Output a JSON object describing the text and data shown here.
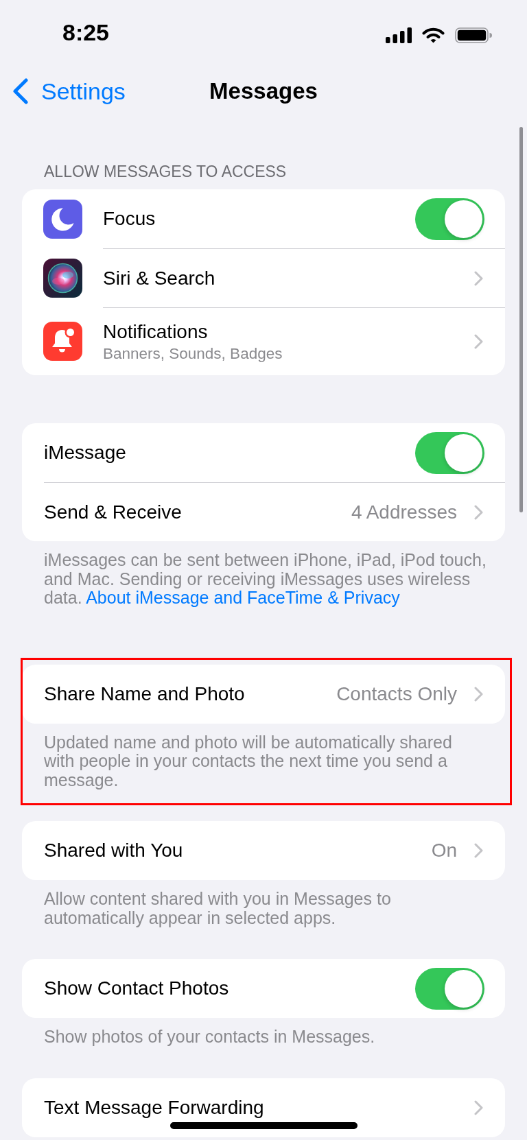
{
  "status_bar": {
    "time": "8:25"
  },
  "nav_bar": {
    "back_label": "Settings",
    "title": "Messages"
  },
  "sections": [
    {
      "header": "ALLOW MESSAGES TO ACCESS",
      "highlighted": false,
      "rows": [
        {
          "kind": "toggle",
          "label": "Focus",
          "on": true
        },
        {
          "kind": "link",
          "label": "Siri & Search"
        },
        {
          "kind": "link",
          "label": "Notifications",
          "subtitle": "Banners, Sounds, Badges"
        }
      ]
    },
    {
      "highlighted": false,
      "rows": [
        {
          "kind": "toggle",
          "label": "iMessage",
          "on": true
        },
        {
          "kind": "link",
          "label": "Send & Receive",
          "value": "4 Addresses"
        }
      ],
      "footer": "iMessages can be sent between iPhone, iPad, iPod touch,\nand Mac. Sending or receiving iMessages uses wireless\ndata.",
      "footer_link": "About iMessage and FaceTime & Privacy"
    },
    {
      "highlighted": true,
      "rows": [
        {
          "kind": "link",
          "label": "Share Name and Photo",
          "value": "Contacts Only"
        }
      ],
      "footer": "Updated name and photo will be automatically shared\nwith people in your contacts the next time you send a\nmessage."
    },
    {
      "highlighted": false,
      "rows": [
        {
          "kind": "link",
          "label": "Shared with You",
          "value": "On"
        }
      ],
      "footer": "Allow content shared with you in Messages to\nautomatically appear in selected apps."
    },
    {
      "highlighted": false,
      "rows": [
        {
          "kind": "toggle",
          "label": "Show Contact Photos",
          "on": true
        }
      ],
      "footer": "Show photos of your contacts in Messages."
    },
    {
      "highlighted": false,
      "rows": [
        {
          "kind": "link",
          "label": "Text Message Forwarding"
        }
      ]
    }
  ]
}
